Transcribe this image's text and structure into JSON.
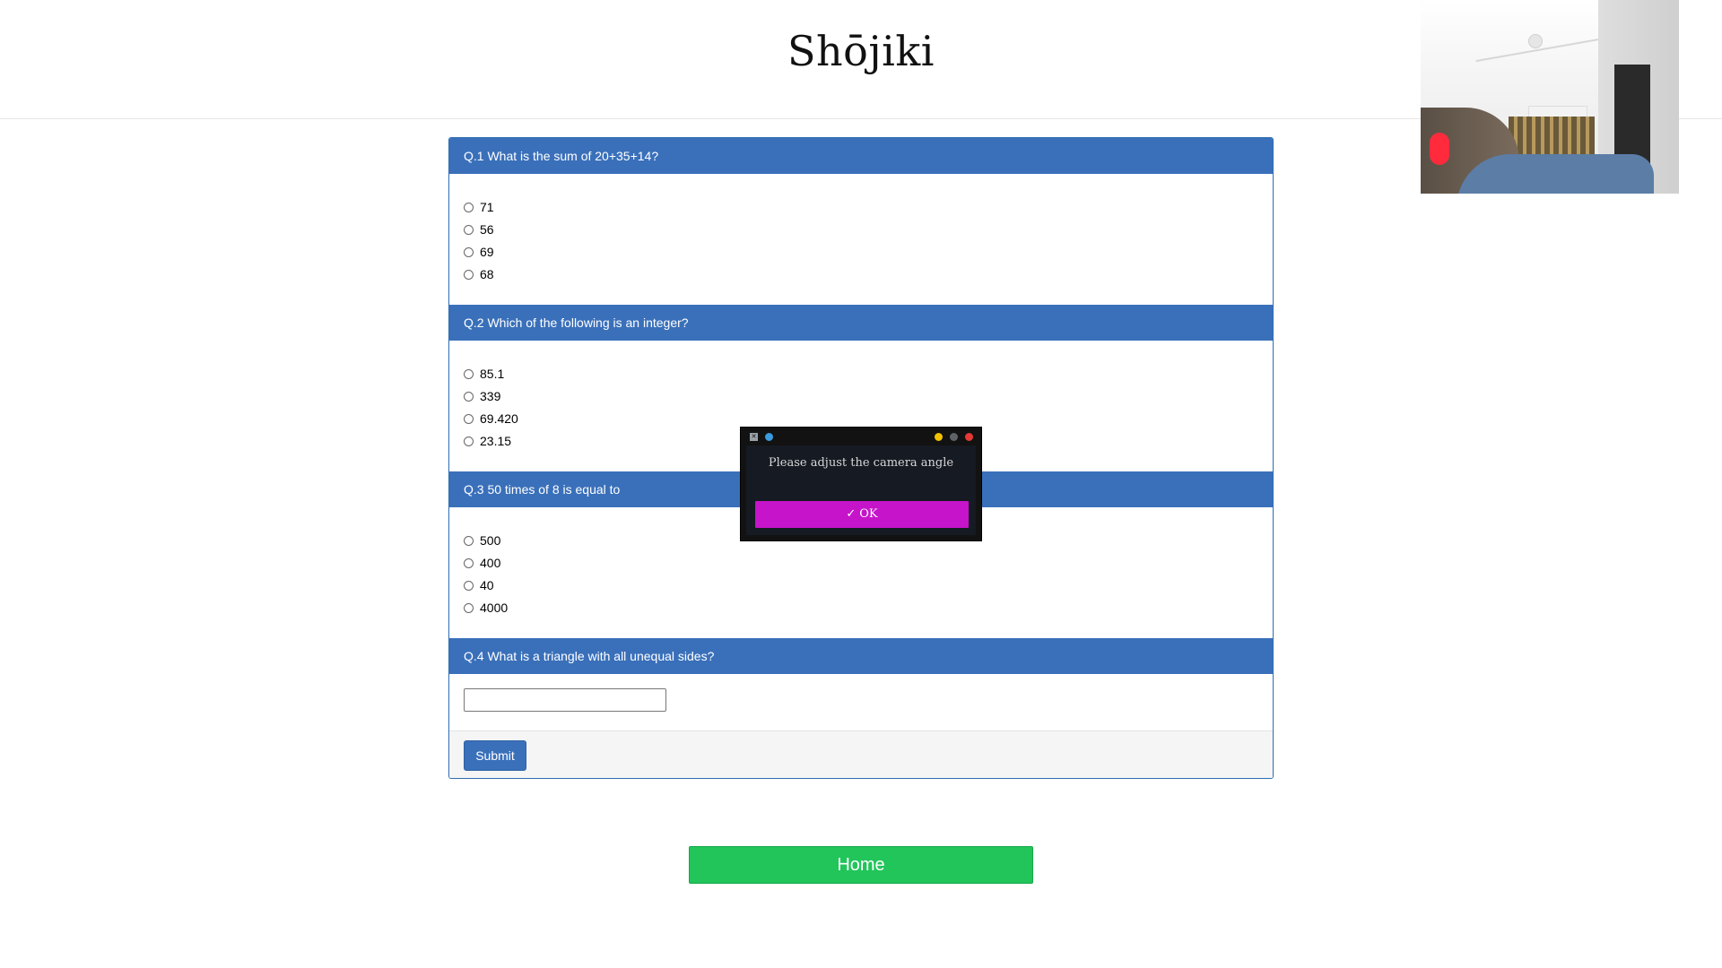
{
  "app": {
    "title": "Shōjiki"
  },
  "quiz": {
    "questions": [
      {
        "label": "Q.1 What is the sum of 20+35+14?",
        "options": [
          "71",
          "56",
          "69",
          "68"
        ]
      },
      {
        "label": "Q.2 Which of the following is an integer?",
        "options": [
          "85.1",
          "339",
          "69.420",
          "23.15"
        ]
      },
      {
        "label": "Q.3 50 times of 8 is equal to",
        "options": [
          "500",
          "400",
          "40",
          "4000"
        ]
      },
      {
        "label": "Q.4 What is a triangle with all unequal sides?",
        "answer_value": ""
      }
    ],
    "submit_label": "Submit"
  },
  "home_label": "Home",
  "dialog": {
    "message": "Please adjust the camera angle",
    "ok_label": "OK",
    "ok_icon": "check-icon",
    "colors": {
      "ok_button": "#c514c9",
      "background": "#161a22"
    }
  },
  "colors": {
    "header_bar": "#3a70ba",
    "home_button": "#21c55a"
  }
}
